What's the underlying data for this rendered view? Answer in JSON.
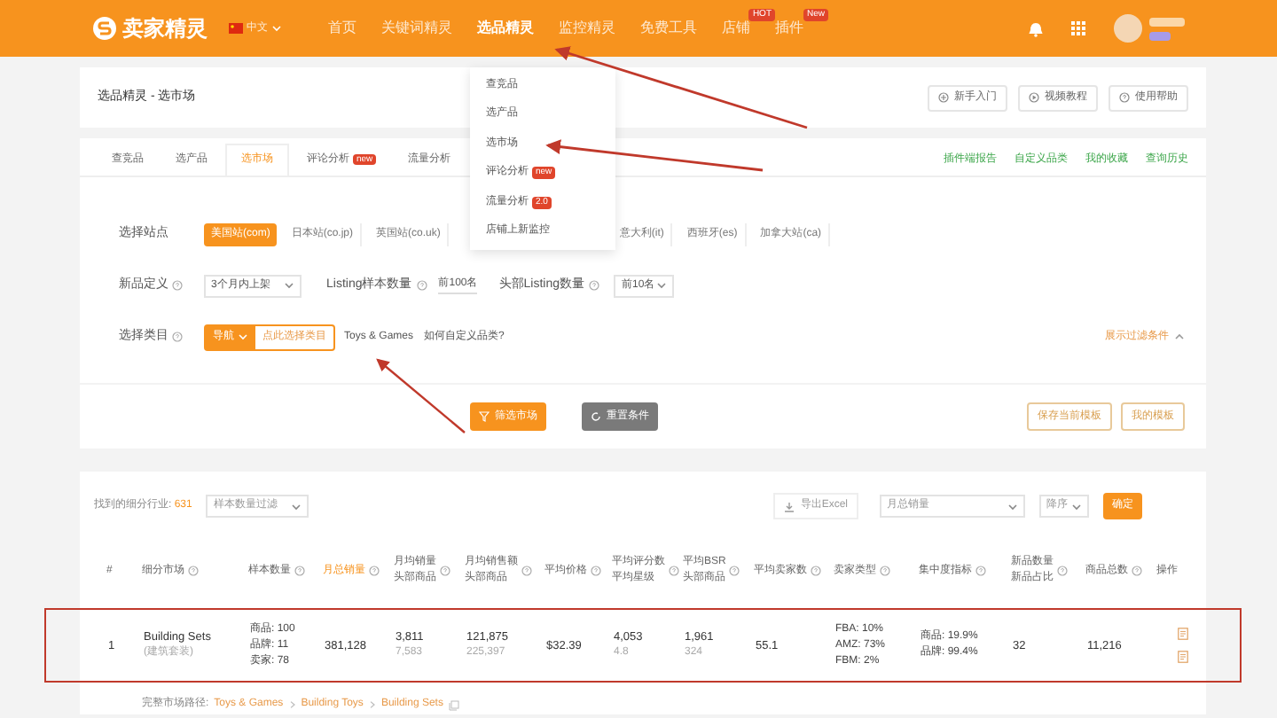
{
  "nav": {
    "logo": "卖家精灵",
    "language": "中文",
    "items": [
      {
        "label": "首页",
        "selected": false
      },
      {
        "label": "关键词精灵",
        "selected": false
      },
      {
        "label": "选品精灵",
        "selected": true
      },
      {
        "label": "监控精灵",
        "selected": false
      },
      {
        "label": "免费工具",
        "selected": false
      },
      {
        "label": "店铺",
        "selected": false,
        "badge": "HOT"
      },
      {
        "label": "插件",
        "selected": false,
        "badge": "New"
      }
    ]
  },
  "breadcrumb": "选品精灵 - 选市场",
  "help_buttons": [
    {
      "label": "新手入门",
      "kind": "plus"
    },
    {
      "label": "视频教程",
      "kind": "play"
    },
    {
      "label": "使用帮助",
      "kind": "help"
    }
  ],
  "tabs": [
    {
      "label": "查竞品",
      "selected": false
    },
    {
      "label": "选产品",
      "selected": false
    },
    {
      "label": "选市场",
      "selected": true
    },
    {
      "label": "评论分析",
      "selected": false,
      "badge": "new"
    },
    {
      "label": "流量分析",
      "selected": false
    }
  ],
  "side_links": [
    "插件端报告",
    "自定义品类",
    "我的收藏",
    "查询历史"
  ],
  "dropdown_menu": [
    {
      "label": "查竞品"
    },
    {
      "label": "选产品"
    },
    {
      "label": "选市场"
    },
    {
      "label": "评论分析",
      "badge": "new"
    },
    {
      "label": "流量分析",
      "badge": "2.0"
    },
    {
      "label": "店铺上新监控"
    }
  ],
  "filters": {
    "site_label": "选择站点",
    "sites": [
      {
        "label": "美国站(com)",
        "selected": true
      },
      {
        "label": "日本站(co.jp)",
        "selected": false
      },
      {
        "label": "英国站(co.uk)",
        "selected": false
      },
      {
        "label": "意大利(it)",
        "selected": false
      },
      {
        "label": "西班牙(es)",
        "selected": false
      },
      {
        "label": "加拿大站(ca)",
        "selected": false
      }
    ],
    "new_product": {
      "label": "新品定义",
      "value": "3个月内上架"
    },
    "listing_sample": {
      "label": "Listing样本数量",
      "value": "前100名"
    },
    "top_listing": {
      "label": "头部Listing数量",
      "value": "前10名"
    },
    "category": {
      "label": "选择类目",
      "nav_button": "导航",
      "picker": "点此选择类目",
      "value": "Toys & Games",
      "help_link": "如何自定义品类?"
    },
    "toggle": "展示过滤条件"
  },
  "actions": [
    {
      "label": "筛选市场",
      "kind": "primary"
    },
    {
      "label": "重置条件",
      "kind": "reset"
    }
  ],
  "templates": [
    "保存当前模板",
    "我的模板"
  ],
  "results": {
    "found_label": "找到的细分行业:",
    "found_count": "631",
    "sample_filter": "样本数量过滤",
    "export": "导出Excel",
    "sort_field": "月总销量",
    "sort_order": "降序",
    "confirm": "确定"
  },
  "table": {
    "columns": [
      {
        "lines": [
          "#"
        ],
        "help": false,
        "highlighted": false
      },
      {
        "lines": [
          "细分市场"
        ],
        "help": true,
        "highlighted": false
      },
      {
        "lines": [
          "样本数量"
        ],
        "help": true,
        "highlighted": false
      },
      {
        "lines": [
          "月总销量"
        ],
        "help": true,
        "highlighted": true
      },
      {
        "lines": [
          "月均销量",
          "头部商品"
        ],
        "help": true,
        "highlighted": false
      },
      {
        "lines": [
          "月均销售额",
          "头部商品"
        ],
        "help": true,
        "highlighted": false
      },
      {
        "lines": [
          "平均价格"
        ],
        "help": true,
        "highlighted": false
      },
      {
        "lines": [
          "平均评分数",
          "平均星级"
        ],
        "help": true,
        "highlighted": false
      },
      {
        "lines": [
          "平均BSR",
          "头部商品"
        ],
        "help": true,
        "highlighted": false
      },
      {
        "lines": [
          "平均卖家数"
        ],
        "help": true,
        "highlighted": false
      },
      {
        "lines": [
          "卖家类型"
        ],
        "help": true,
        "highlighted": false
      },
      {
        "lines": [
          "集中度指标"
        ],
        "help": true,
        "highlighted": false
      },
      {
        "lines": [
          "新品数量",
          "新品占比"
        ],
        "help": true,
        "highlighted": false
      },
      {
        "lines": [
          "商品总数"
        ],
        "help": true,
        "highlighted": false
      },
      {
        "lines": [
          "操作"
        ],
        "help": false,
        "highlighted": false
      }
    ],
    "rows": [
      {
        "cells": [
          {
            "kind": "pair",
            "lines": [
              "1"
            ]
          },
          {
            "kind": "pair",
            "lines": [
              "Building Sets",
              "(建筑套装)"
            ]
          },
          {
            "kind": "list",
            "lines": [
              "商品: 100",
              "品牌: 11",
              "卖家: 78"
            ]
          },
          {
            "kind": "pair",
            "lines": [
              "381,128"
            ]
          },
          {
            "kind": "pair",
            "lines": [
              "3,811",
              "7,583"
            ]
          },
          {
            "kind": "pair",
            "lines": [
              "121,875",
              "225,397"
            ]
          },
          {
            "kind": "pair",
            "lines": [
              "$32.39"
            ]
          },
          {
            "kind": "pair",
            "lines": [
              "4,053",
              "4.8"
            ]
          },
          {
            "kind": "pair",
            "lines": [
              "1,961",
              "324"
            ]
          },
          {
            "kind": "pair",
            "lines": [
              "55.1"
            ]
          },
          {
            "kind": "list",
            "lines": [
              "FBA: 10%",
              "AMZ: 73%",
              "FBM: 2%"
            ]
          },
          {
            "kind": "list",
            "lines": [
              "商品: 19.9%",
              "品牌: 99.4%"
            ]
          },
          {
            "kind": "pair",
            "lines": [
              "32"
            ]
          },
          {
            "kind": "pair",
            "lines": [
              "11,216"
            ]
          },
          {
            "kind": "ops"
          }
        ]
      }
    ]
  },
  "path": {
    "label": "完整市场路径:",
    "items": [
      "Toys & Games",
      "Building Toys",
      "Building Sets"
    ]
  }
}
